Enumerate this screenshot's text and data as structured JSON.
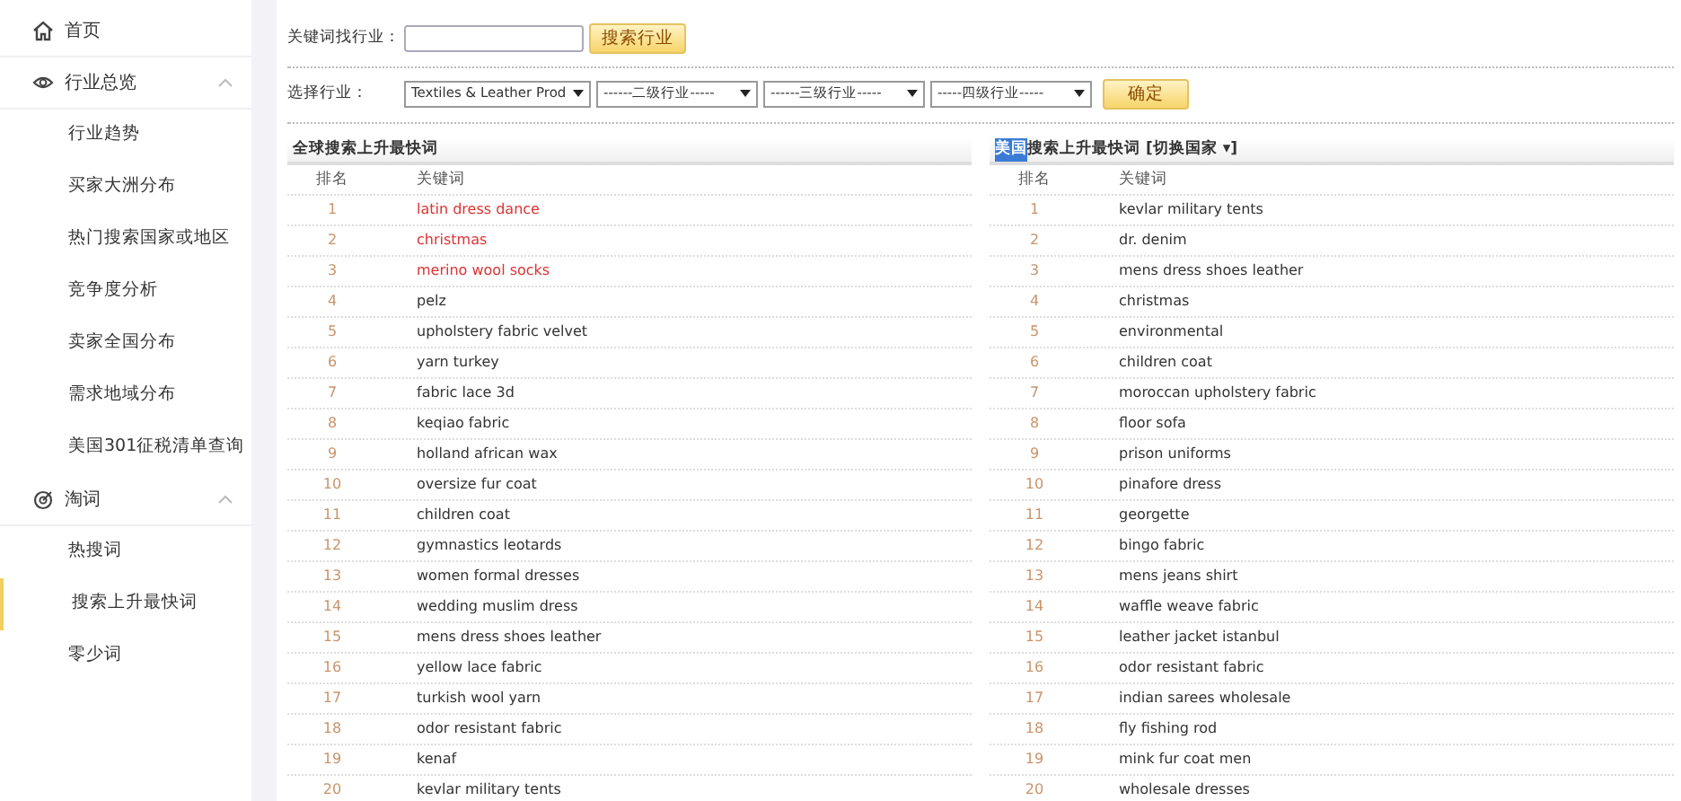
{
  "sidebar": {
    "items": [
      {
        "label": "首页",
        "selected": false
      },
      {
        "label": "行业总览",
        "expanded": true,
        "children": [
          {
            "label": "行业趋势",
            "selected": false
          },
          {
            "label": "买家大洲分布",
            "selected": false
          },
          {
            "label": "热门搜索国家或地区",
            "selected": false
          },
          {
            "label": "竞争度分析",
            "selected": false
          },
          {
            "label": "卖家全国分布",
            "selected": false
          },
          {
            "label": "需求地域分布",
            "selected": false
          },
          {
            "label": "美国301征税清单查询",
            "selected": false
          }
        ]
      },
      {
        "label": "淘词",
        "expanded": true,
        "children": [
          {
            "label": "热搜词",
            "selected": false
          },
          {
            "label": "搜索上升最快词",
            "selected": true
          },
          {
            "label": "零少词",
            "selected": false
          }
        ]
      }
    ]
  },
  "search_form": {
    "label": "关键词找行业：",
    "button": "搜索行业"
  },
  "industry_form": {
    "label": "选择行业：",
    "selects": [
      "Textiles & Leather Prod",
      "------二级行业-----",
      "------三级行业-----",
      "-----四级行业-----"
    ],
    "button": "确定"
  },
  "tables": [
    {
      "title": "全球搜索上升最快词",
      "columns": [
        "排名",
        "关键词"
      ],
      "rows": [
        {
          "rank": "1",
          "keyword": "latin dress dance",
          "hot": true
        },
        {
          "rank": "2",
          "keyword": "christmas",
          "hot": true
        },
        {
          "rank": "3",
          "keyword": "merino wool socks",
          "hot": true
        },
        {
          "rank": "4",
          "keyword": "pelz",
          "hot": false
        },
        {
          "rank": "5",
          "keyword": "upholstery fabric velvet",
          "hot": false
        },
        {
          "rank": "6",
          "keyword": "yarn turkey",
          "hot": false
        },
        {
          "rank": "7",
          "keyword": "fabric lace 3d",
          "hot": false
        },
        {
          "rank": "8",
          "keyword": "keqiao fabric",
          "hot": false
        },
        {
          "rank": "9",
          "keyword": "holland african wax",
          "hot": false
        },
        {
          "rank": "10",
          "keyword": "oversize fur coat",
          "hot": false
        },
        {
          "rank": "11",
          "keyword": "children coat",
          "hot": false
        },
        {
          "rank": "12",
          "keyword": "gymnastics leotards",
          "hot": false
        },
        {
          "rank": "13",
          "keyword": "women formal dresses",
          "hot": false
        },
        {
          "rank": "14",
          "keyword": "wedding muslim dress",
          "hot": false
        },
        {
          "rank": "15",
          "keyword": "mens dress shoes leather",
          "hot": false
        },
        {
          "rank": "16",
          "keyword": "yellow lace fabric",
          "hot": false
        },
        {
          "rank": "17",
          "keyword": "turkish wool yarn",
          "hot": false
        },
        {
          "rank": "18",
          "keyword": "odor resistant fabric",
          "hot": false
        },
        {
          "rank": "19",
          "keyword": "kenaf",
          "hot": false
        },
        {
          "rank": "20",
          "keyword": "kevlar military tents",
          "hot": false
        }
      ]
    },
    {
      "country": "美国",
      "title": "搜索上升最快词",
      "switch_link": "[切换国家 ▾]",
      "columns": [
        "排名",
        "关键词"
      ],
      "rows": [
        {
          "rank": "1",
          "keyword": "kevlar military tents",
          "hot": false
        },
        {
          "rank": "2",
          "keyword": "dr. denim",
          "hot": false
        },
        {
          "rank": "3",
          "keyword": "mens dress shoes leather",
          "hot": false
        },
        {
          "rank": "4",
          "keyword": "christmas",
          "hot": false
        },
        {
          "rank": "5",
          "keyword": "environmental",
          "hot": false
        },
        {
          "rank": "6",
          "keyword": "children coat",
          "hot": false
        },
        {
          "rank": "7",
          "keyword": "moroccan upholstery fabric",
          "hot": false
        },
        {
          "rank": "8",
          "keyword": "floor sofa",
          "hot": false
        },
        {
          "rank": "9",
          "keyword": "prison uniforms",
          "hot": false
        },
        {
          "rank": "10",
          "keyword": "pinafore dress",
          "hot": false
        },
        {
          "rank": "11",
          "keyword": "georgette",
          "hot": false
        },
        {
          "rank": "12",
          "keyword": "bingo fabric",
          "hot": false
        },
        {
          "rank": "13",
          "keyword": "mens jeans shirt",
          "hot": false
        },
        {
          "rank": "14",
          "keyword": "waffle weave fabric",
          "hot": false
        },
        {
          "rank": "15",
          "keyword": "leather jacket istanbul",
          "hot": false
        },
        {
          "rank": "16",
          "keyword": "odor resistant fabric",
          "hot": false
        },
        {
          "rank": "17",
          "keyword": "indian sarees wholesale",
          "hot": false
        },
        {
          "rank": "18",
          "keyword": "fly fishing rod",
          "hot": false
        },
        {
          "rank": "19",
          "keyword": "mink fur coat men",
          "hot": false
        },
        {
          "rank": "20",
          "keyword": "wholesale dresses",
          "hot": false
        }
      ]
    }
  ]
}
